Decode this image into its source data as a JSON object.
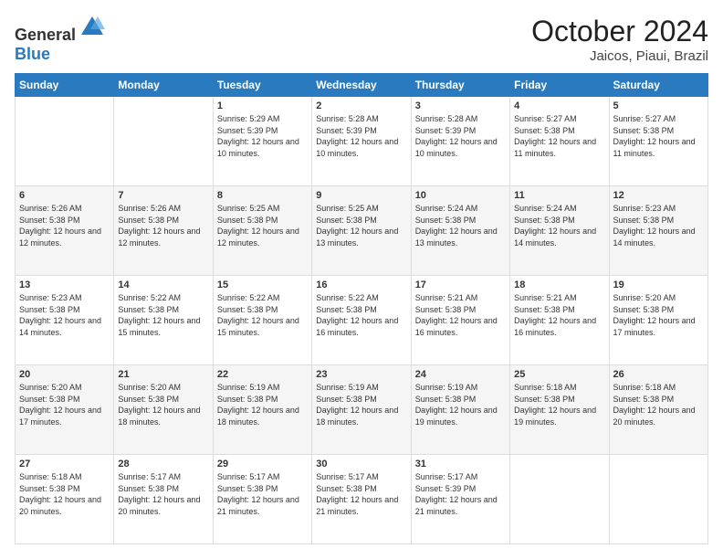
{
  "header": {
    "logo_line1": "General",
    "logo_line2": "Blue",
    "month": "October 2024",
    "location": "Jaicos, Piaui, Brazil"
  },
  "weekdays": [
    "Sunday",
    "Monday",
    "Tuesday",
    "Wednesday",
    "Thursday",
    "Friday",
    "Saturday"
  ],
  "weeks": [
    [
      {
        "day": "",
        "info": ""
      },
      {
        "day": "",
        "info": ""
      },
      {
        "day": "1",
        "info": "Sunrise: 5:29 AM\nSunset: 5:39 PM\nDaylight: 12 hours and 10 minutes."
      },
      {
        "day": "2",
        "info": "Sunrise: 5:28 AM\nSunset: 5:39 PM\nDaylight: 12 hours and 10 minutes."
      },
      {
        "day": "3",
        "info": "Sunrise: 5:28 AM\nSunset: 5:39 PM\nDaylight: 12 hours and 10 minutes."
      },
      {
        "day": "4",
        "info": "Sunrise: 5:27 AM\nSunset: 5:38 PM\nDaylight: 12 hours and 11 minutes."
      },
      {
        "day": "5",
        "info": "Sunrise: 5:27 AM\nSunset: 5:38 PM\nDaylight: 12 hours and 11 minutes."
      }
    ],
    [
      {
        "day": "6",
        "info": "Sunrise: 5:26 AM\nSunset: 5:38 PM\nDaylight: 12 hours and 12 minutes."
      },
      {
        "day": "7",
        "info": "Sunrise: 5:26 AM\nSunset: 5:38 PM\nDaylight: 12 hours and 12 minutes."
      },
      {
        "day": "8",
        "info": "Sunrise: 5:25 AM\nSunset: 5:38 PM\nDaylight: 12 hours and 12 minutes."
      },
      {
        "day": "9",
        "info": "Sunrise: 5:25 AM\nSunset: 5:38 PM\nDaylight: 12 hours and 13 minutes."
      },
      {
        "day": "10",
        "info": "Sunrise: 5:24 AM\nSunset: 5:38 PM\nDaylight: 12 hours and 13 minutes."
      },
      {
        "day": "11",
        "info": "Sunrise: 5:24 AM\nSunset: 5:38 PM\nDaylight: 12 hours and 14 minutes."
      },
      {
        "day": "12",
        "info": "Sunrise: 5:23 AM\nSunset: 5:38 PM\nDaylight: 12 hours and 14 minutes."
      }
    ],
    [
      {
        "day": "13",
        "info": "Sunrise: 5:23 AM\nSunset: 5:38 PM\nDaylight: 12 hours and 14 minutes."
      },
      {
        "day": "14",
        "info": "Sunrise: 5:22 AM\nSunset: 5:38 PM\nDaylight: 12 hours and 15 minutes."
      },
      {
        "day": "15",
        "info": "Sunrise: 5:22 AM\nSunset: 5:38 PM\nDaylight: 12 hours and 15 minutes."
      },
      {
        "day": "16",
        "info": "Sunrise: 5:22 AM\nSunset: 5:38 PM\nDaylight: 12 hours and 16 minutes."
      },
      {
        "day": "17",
        "info": "Sunrise: 5:21 AM\nSunset: 5:38 PM\nDaylight: 12 hours and 16 minutes."
      },
      {
        "day": "18",
        "info": "Sunrise: 5:21 AM\nSunset: 5:38 PM\nDaylight: 12 hours and 16 minutes."
      },
      {
        "day": "19",
        "info": "Sunrise: 5:20 AM\nSunset: 5:38 PM\nDaylight: 12 hours and 17 minutes."
      }
    ],
    [
      {
        "day": "20",
        "info": "Sunrise: 5:20 AM\nSunset: 5:38 PM\nDaylight: 12 hours and 17 minutes."
      },
      {
        "day": "21",
        "info": "Sunrise: 5:20 AM\nSunset: 5:38 PM\nDaylight: 12 hours and 18 minutes."
      },
      {
        "day": "22",
        "info": "Sunrise: 5:19 AM\nSunset: 5:38 PM\nDaylight: 12 hours and 18 minutes."
      },
      {
        "day": "23",
        "info": "Sunrise: 5:19 AM\nSunset: 5:38 PM\nDaylight: 12 hours and 18 minutes."
      },
      {
        "day": "24",
        "info": "Sunrise: 5:19 AM\nSunset: 5:38 PM\nDaylight: 12 hours and 19 minutes."
      },
      {
        "day": "25",
        "info": "Sunrise: 5:18 AM\nSunset: 5:38 PM\nDaylight: 12 hours and 19 minutes."
      },
      {
        "day": "26",
        "info": "Sunrise: 5:18 AM\nSunset: 5:38 PM\nDaylight: 12 hours and 20 minutes."
      }
    ],
    [
      {
        "day": "27",
        "info": "Sunrise: 5:18 AM\nSunset: 5:38 PM\nDaylight: 12 hours and 20 minutes."
      },
      {
        "day": "28",
        "info": "Sunrise: 5:17 AM\nSunset: 5:38 PM\nDaylight: 12 hours and 20 minutes."
      },
      {
        "day": "29",
        "info": "Sunrise: 5:17 AM\nSunset: 5:38 PM\nDaylight: 12 hours and 21 minutes."
      },
      {
        "day": "30",
        "info": "Sunrise: 5:17 AM\nSunset: 5:38 PM\nDaylight: 12 hours and 21 minutes."
      },
      {
        "day": "31",
        "info": "Sunrise: 5:17 AM\nSunset: 5:39 PM\nDaylight: 12 hours and 21 minutes."
      },
      {
        "day": "",
        "info": ""
      },
      {
        "day": "",
        "info": ""
      }
    ]
  ]
}
